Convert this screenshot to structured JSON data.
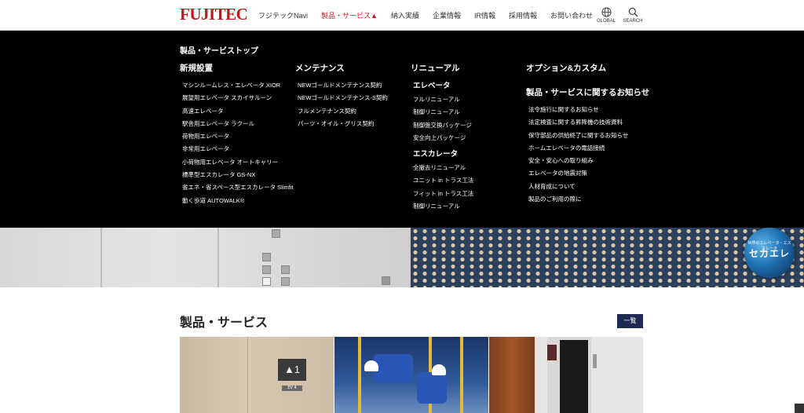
{
  "header": {
    "logo": "FUJITEC",
    "nav": [
      {
        "label": "フジテックNavi",
        "active": false
      },
      {
        "label": "製品・サービス▲",
        "active": true
      },
      {
        "label": "納入実績",
        "active": false
      },
      {
        "label": "企業情報",
        "active": false
      },
      {
        "label": "IR情報",
        "active": false
      },
      {
        "label": "採用情報",
        "active": false
      },
      {
        "label": "お問い合わせ",
        "active": false
      }
    ],
    "global_label": "GLOBAL",
    "search_label": "SEARCH"
  },
  "mega_menu": {
    "top_link": "製品・サービストップ",
    "col1": {
      "heading": "新規設置",
      "items": [
        "マシンルームレス・エレベータ XIOR",
        "展望用エレベータ スカイサルーン",
        "高速エレベータ",
        "駅舎用エレベータ ラクール",
        "荷物用エレベータ",
        "非常用エレベータ",
        "小荷物用エレベータ オートキャリー",
        "標準型エスカレータ GS-NX",
        "省エネ・省スペース型エスカレータ Slimfit",
        "動く歩道 AUTOWALK®"
      ]
    },
    "col2": {
      "heading": "メンテナンス",
      "items": [
        "NEWゴールドメンテナンス契約",
        "NEWゴールドメンテナンス-S契約",
        "フルメンテナンス契約",
        "パーツ・オイル・グリス契約"
      ]
    },
    "col3": {
      "heading": "リニューアル",
      "sub1": "エレベータ",
      "sub1_items": [
        "フルリニューアル",
        "制御リニューアル",
        "制御盤交換パッケージ",
        "安全向上パッケージ"
      ],
      "sub2": "エスカレータ",
      "sub2_items": [
        "全撤去リニューアル",
        "ユニット in トラス工法",
        "フィット in トラス工法",
        "制御リニューアル"
      ]
    },
    "col4": {
      "heading": "オプション&カスタム",
      "heading2": "製品・サービスに関するお知らせ",
      "items": [
        "法令施行に関するお知らせ",
        "法定検査に関する昇降機の技術資料",
        "保守部品の供給終了に関するお知らせ",
        "ホームエレベータの電話接続",
        "安全・安心への取り組み",
        "エレベータの地震対策",
        "人材育成について",
        "製品のご利用の際に"
      ]
    }
  },
  "hero": {
    "badge_subtitle": "世界のエレベータ・エスカレータ",
    "badge_title": "セカエレ"
  },
  "section": {
    "title": "製品・サービス",
    "list_button": "一覧"
  },
  "cards": [
    {
      "sign": "▲1",
      "plate": "EV 4"
    }
  ],
  "colors": {
    "brand_red": "#c4161c",
    "menu_bg": "#000000",
    "button_navy": "#1e2a52"
  }
}
